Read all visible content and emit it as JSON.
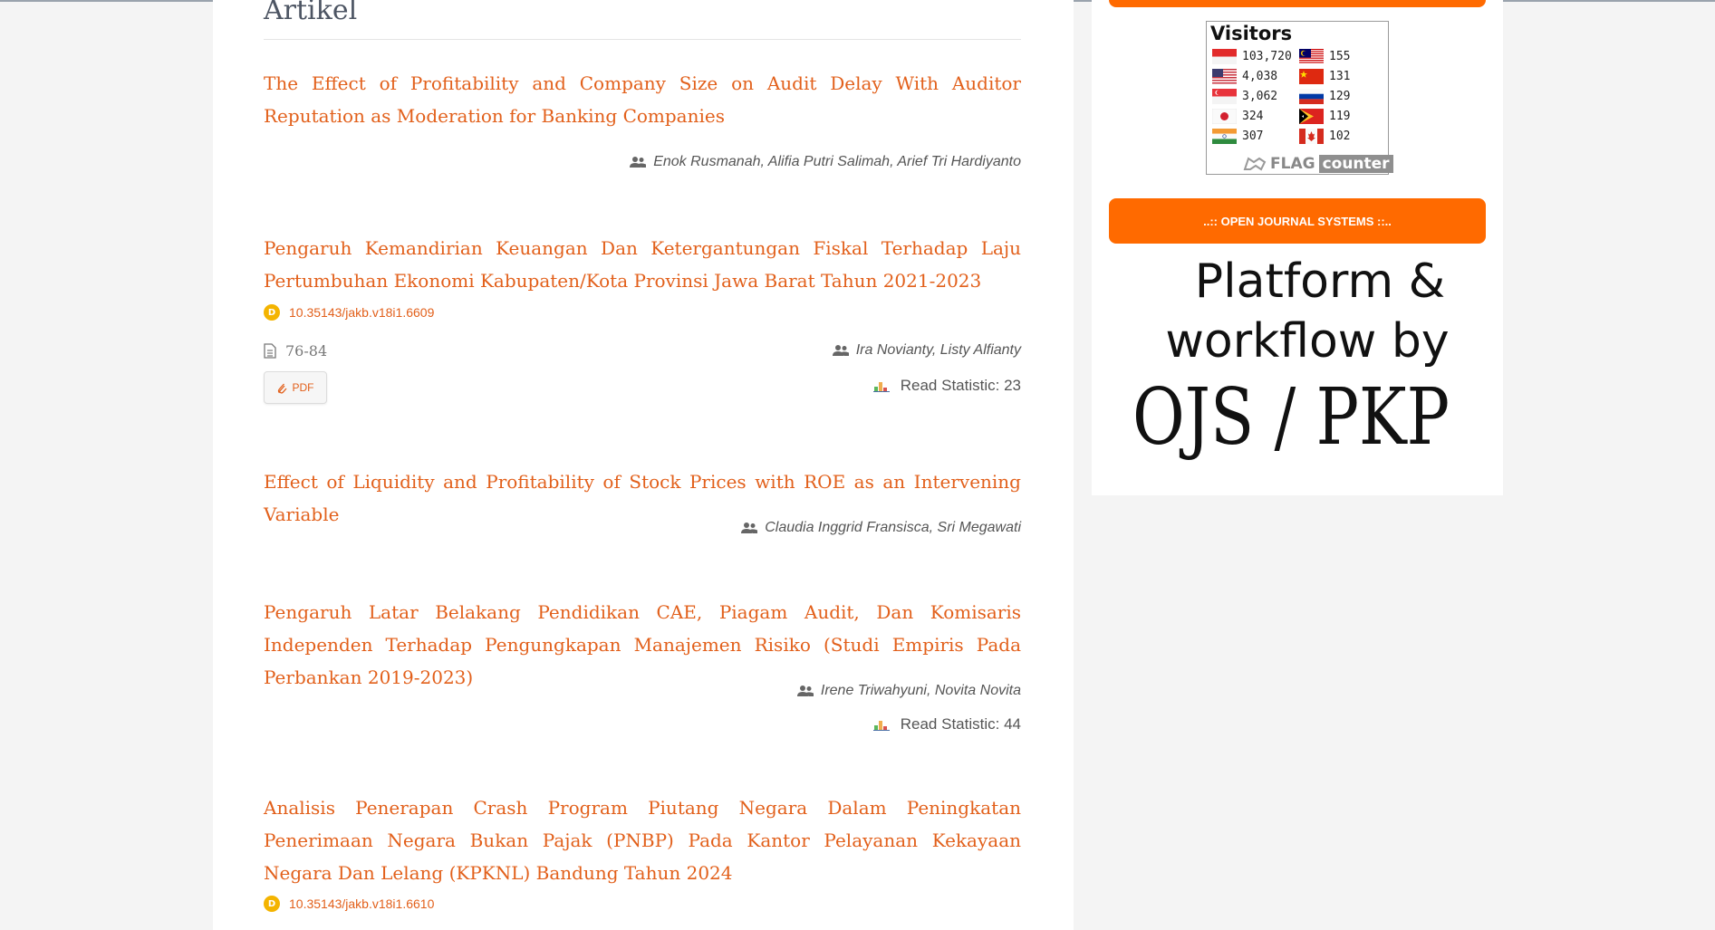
{
  "main": {
    "section_title": "Artikel",
    "articles": [
      {
        "title": "The Effect of Profitability and Company Size on Audit Delay With Auditor Reputation as Moderation for Banking Companies",
        "authors": "Enok Rusmanah, Alifia Putri Salimah, Arief Tri Hardiyanto"
      },
      {
        "title": "Pengaruh Kemandirian Keuangan Dan Ketergantungan Fiskal Terhadap Laju Pertumbuhan Ekonomi Kabupaten/Kota Provinsi Jawa Barat Tahun 2021-2023",
        "doi": "10.35143/jakb.v18i1.6609",
        "pages": "76-84",
        "authors": "Ira Novianty, Listy Alfianty",
        "pdf_label": "PDF",
        "read_statistic": "Read Statistic: 23"
      },
      {
        "title": "Effect of Liquidity and Profitability of Stock Prices with ROE as an Intervening Variable",
        "authors": "Claudia Inggrid Fransisca, Sri Megawati"
      },
      {
        "title": "Pengaruh Latar Belakang Pendidikan CAE, Piagam Audit, Dan Komisaris Independen Terhadap Pengungkapan Manajemen Risiko (Studi Empiris Pada Perbankan 2019-2023)",
        "authors": "Irene Triwahyuni, Novita Novita",
        "read_statistic": "Read Statistic: 44"
      },
      {
        "title": "Analisis Penerapan Crash Program Piutang Negara Dalam Peningkatan Penerimaan Negara Bukan Pajak (PNBP) Pada Kantor Pelayanan Kekayaan Negara Dan Lelang (KPKNL) Bandung Tahun 2024",
        "doi": "10.35143/jakb.v18i1.6610"
      }
    ]
  },
  "sidebar": {
    "flag_counter": {
      "title": "Visitors",
      "left_column": [
        {
          "country": "Indonesia",
          "count": "103,720"
        },
        {
          "country": "United States",
          "count": "4,038"
        },
        {
          "country": "Singapore",
          "count": "3,062"
        },
        {
          "country": "Japan",
          "count": "324"
        },
        {
          "country": "India",
          "count": "307"
        }
      ],
      "right_column": [
        {
          "country": "Malaysia",
          "count": "155"
        },
        {
          "country": "China",
          "count": "131"
        },
        {
          "country": "Russia",
          "count": "129"
        },
        {
          "country": "Timor-Leste",
          "count": "119"
        },
        {
          "country": "Canada",
          "count": "102"
        }
      ],
      "footer_flag": "FLAG",
      "footer_counter": "counter"
    },
    "ojs_banner": "..:: OPEN JOURNAL SYSTEMS ::..",
    "pkp_logo": {
      "line1": "Platform &",
      "line2": "workflow by",
      "line3": "OJS / PKP"
    }
  },
  "colors": {
    "link": "#e2601b",
    "accent_orange": "#ff6a00",
    "page_background": "#f4f4f4"
  },
  "icons": [
    "users-icon",
    "doi-icon",
    "file-icon",
    "paperclip-icon",
    "bar-chart-icon"
  ]
}
